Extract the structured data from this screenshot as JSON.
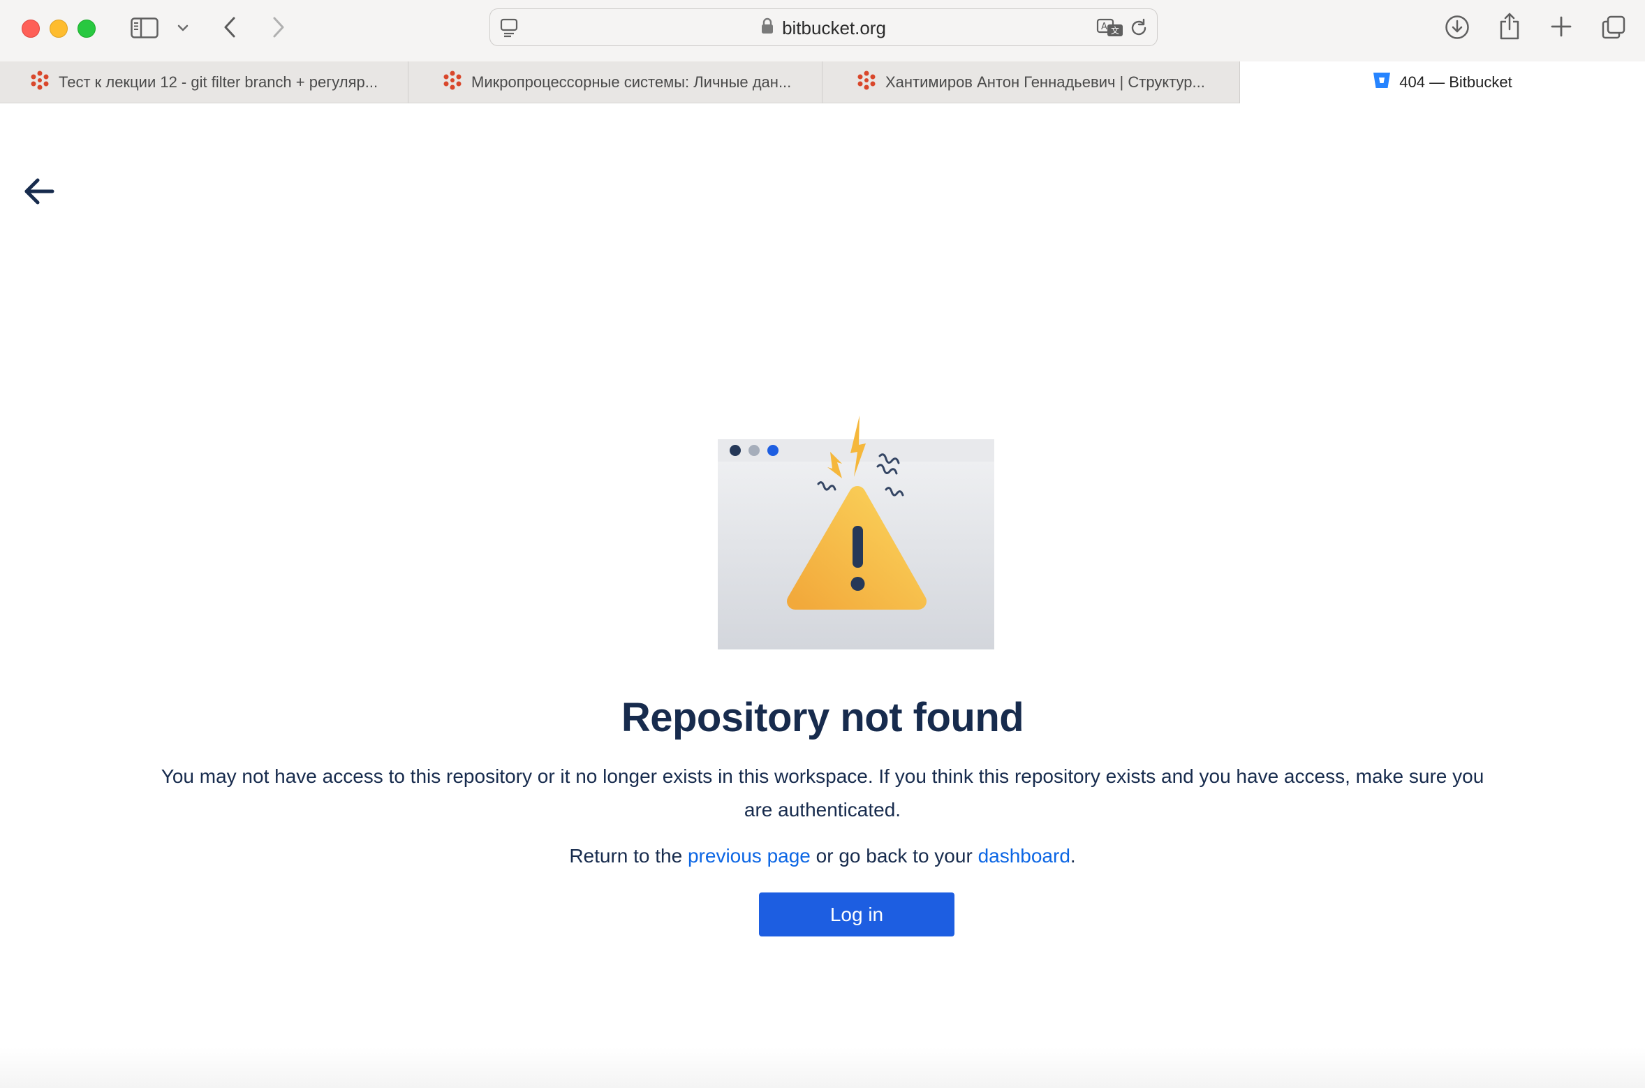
{
  "browser": {
    "url": "bitbucket.org",
    "tabs": [
      {
        "title": "Тест к лекции 12 - git filter branch + регуляр..."
      },
      {
        "title": "Микропроцессорные системы: Личные дан..."
      },
      {
        "title": "Хантимиров Антон Геннадьевич | Структур..."
      },
      {
        "title": "404 — Bitbucket",
        "active": true
      }
    ]
  },
  "page": {
    "title": "Repository not found",
    "description": "You may not have access to this repository or it no longer exists in this workspace. If you think this repository exists and you have access, make sure you are authenticated.",
    "return_prefix": "Return to the ",
    "previous_page_link": "previous page",
    "return_middle": " or go back to your ",
    "dashboard_link": "dashboard",
    "return_suffix": ".",
    "login_button": "Log in"
  },
  "colors": {
    "primary": "#1d5ee1",
    "link": "#0c66e4",
    "heading": "#172b4d",
    "warning": "#f5b73b"
  },
  "icons": [
    "sidebar-icon",
    "chevron-down-icon",
    "back-icon",
    "forward-icon",
    "reader-icon",
    "lock-icon",
    "translate-icon",
    "reload-icon",
    "download-icon",
    "share-icon",
    "new-tab-icon",
    "tab-overview-icon",
    "close-icon",
    "bitbucket-icon",
    "arrow-left-icon",
    "warning-icon"
  ]
}
